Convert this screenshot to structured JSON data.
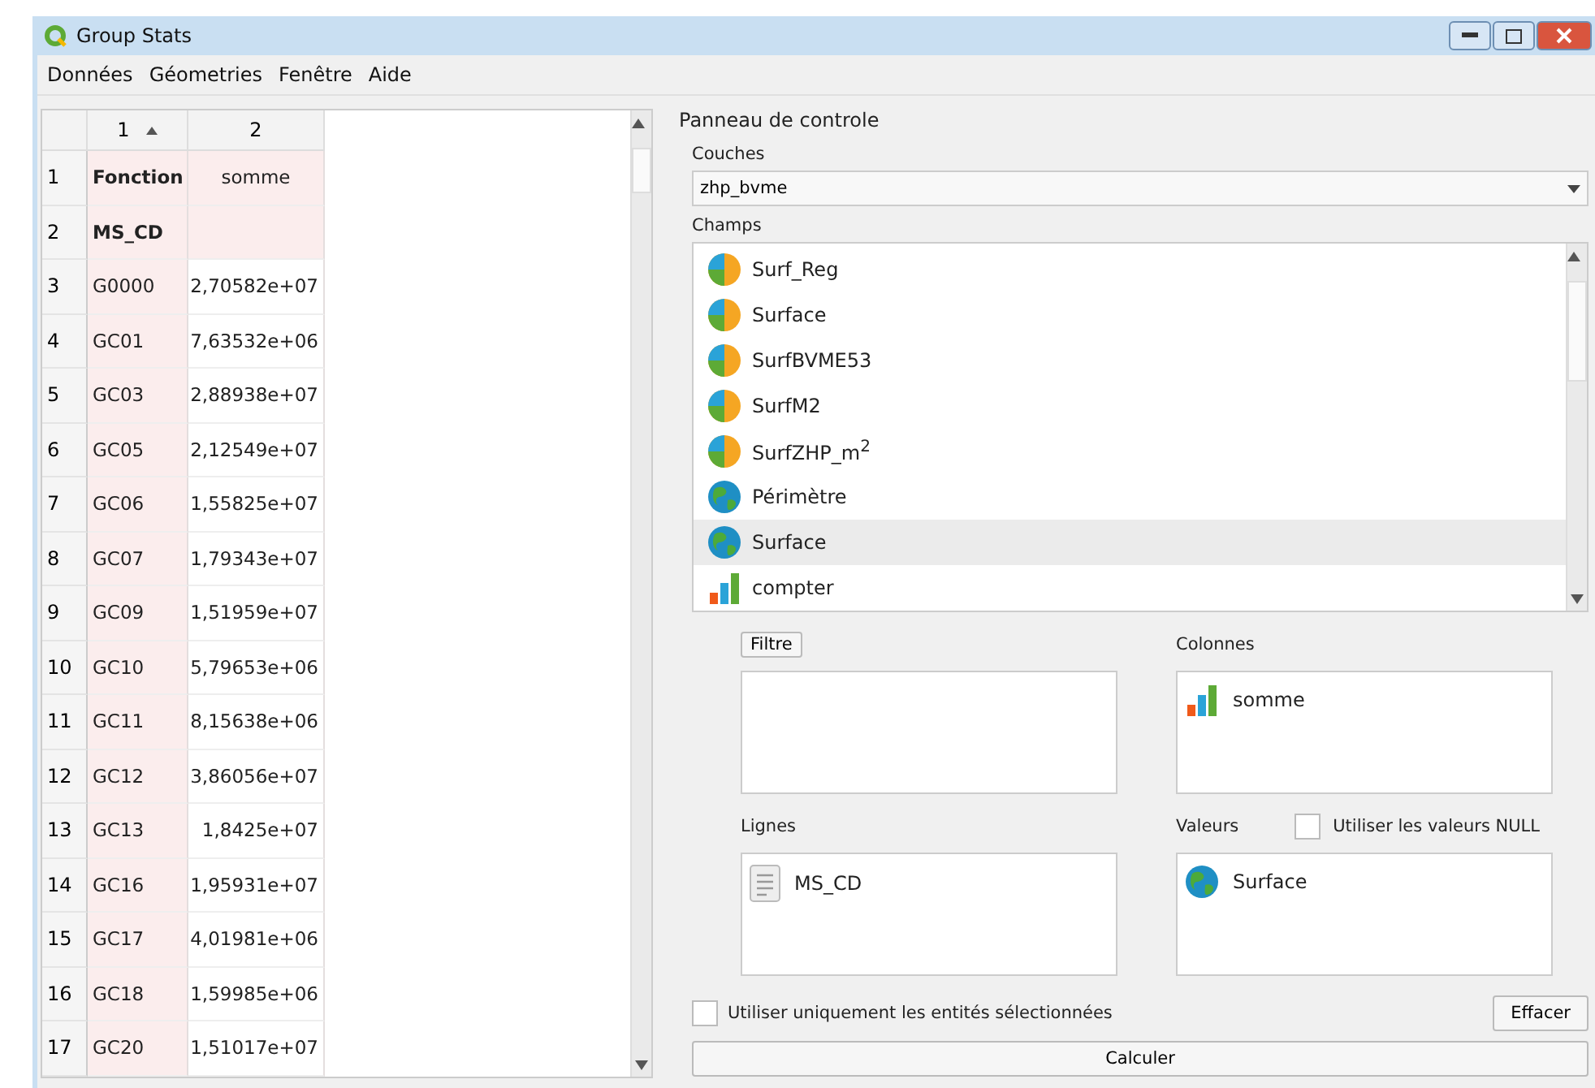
{
  "window": {
    "title": "Group Stats"
  },
  "menu": [
    "Données",
    "Géometries",
    "Fenêtre",
    "Aide"
  ],
  "table": {
    "columns": [
      {
        "label": "1",
        "sorted": true
      },
      {
        "label": "2",
        "sorted": false
      }
    ],
    "rows": [
      {
        "number": "1",
        "kind": "header",
        "cells": [
          "Fonction",
          "somme"
        ]
      },
      {
        "number": "2",
        "kind": "header",
        "cells": [
          "MS_CD",
          ""
        ]
      },
      {
        "number": "3",
        "kind": "data",
        "cells": [
          "G0000",
          "2,70582e+07"
        ]
      },
      {
        "number": "4",
        "kind": "data",
        "cells": [
          "GC01",
          "7,63532e+06"
        ]
      },
      {
        "number": "5",
        "kind": "data",
        "cells": [
          "GC03",
          "2,88938e+07"
        ]
      },
      {
        "number": "6",
        "kind": "data",
        "cells": [
          "GC05",
          "2,12549e+07"
        ]
      },
      {
        "number": "7",
        "kind": "data",
        "cells": [
          "GC06",
          "1,55825e+07"
        ]
      },
      {
        "number": "8",
        "kind": "data",
        "cells": [
          "GC07",
          "1,79343e+07"
        ]
      },
      {
        "number": "9",
        "kind": "data",
        "cells": [
          "GC09",
          "1,51959e+07"
        ]
      },
      {
        "number": "10",
        "kind": "data",
        "cells": [
          "GC10",
          "5,79653e+06"
        ]
      },
      {
        "number": "11",
        "kind": "data",
        "cells": [
          "GC11",
          "8,15638e+06"
        ]
      },
      {
        "number": "12",
        "kind": "data",
        "cells": [
          "GC12",
          "3,86056e+07"
        ]
      },
      {
        "number": "13",
        "kind": "data",
        "cells": [
          "GC13",
          "1,8425e+07"
        ]
      },
      {
        "number": "14",
        "kind": "data",
        "cells": [
          "GC16",
          "1,95931e+07"
        ]
      },
      {
        "number": "15",
        "kind": "data",
        "cells": [
          "GC17",
          "4,01981e+06"
        ]
      },
      {
        "number": "16",
        "kind": "data",
        "cells": [
          "GC18",
          "1,59985e+06"
        ]
      },
      {
        "number": "17",
        "kind": "data",
        "cells": [
          "GC20",
          "1,51017e+07"
        ]
      }
    ]
  },
  "panel": {
    "title": "Panneau de controle",
    "layers_label": "Couches",
    "layer": "zhp_bvme",
    "fields_label": "Champs",
    "fields": [
      {
        "kind": "pie",
        "label": "Surf_Reg",
        "selected": false
      },
      {
        "kind": "pie",
        "label": "Surface",
        "selected": false
      },
      {
        "kind": "pie",
        "label": "SurfBVME53",
        "selected": false
      },
      {
        "kind": "pie",
        "label": "SurfM2",
        "selected": false
      },
      {
        "kind": "pie",
        "label": "SurfZHP_m$^{2}$",
        "selected": false
      },
      {
        "kind": "globe",
        "label": "Périmètre",
        "selected": false
      },
      {
        "kind": "globe",
        "label": "Surface",
        "selected": true
      },
      {
        "kind": "bars",
        "label": "compter",
        "selected": false
      }
    ],
    "filter_button": "Filtre",
    "columns_label": "Colonnes",
    "columns": [
      {
        "kind": "bars",
        "label": "somme"
      }
    ],
    "rows_label": "Lignes",
    "rows": [
      {
        "kind": "text",
        "label": "MS_CD"
      }
    ],
    "values_label": "Valeurs",
    "values": [
      {
        "kind": "globe",
        "label": "Surface"
      }
    ],
    "null_option": {
      "label": "Utiliser les valeurs NULL",
      "checked": false
    },
    "selected_only": {
      "label": "Utiliser uniquement les entités sélectionnées",
      "checked": false
    },
    "clear_button": "Effacer",
    "calculate_button": "Calculer"
  }
}
